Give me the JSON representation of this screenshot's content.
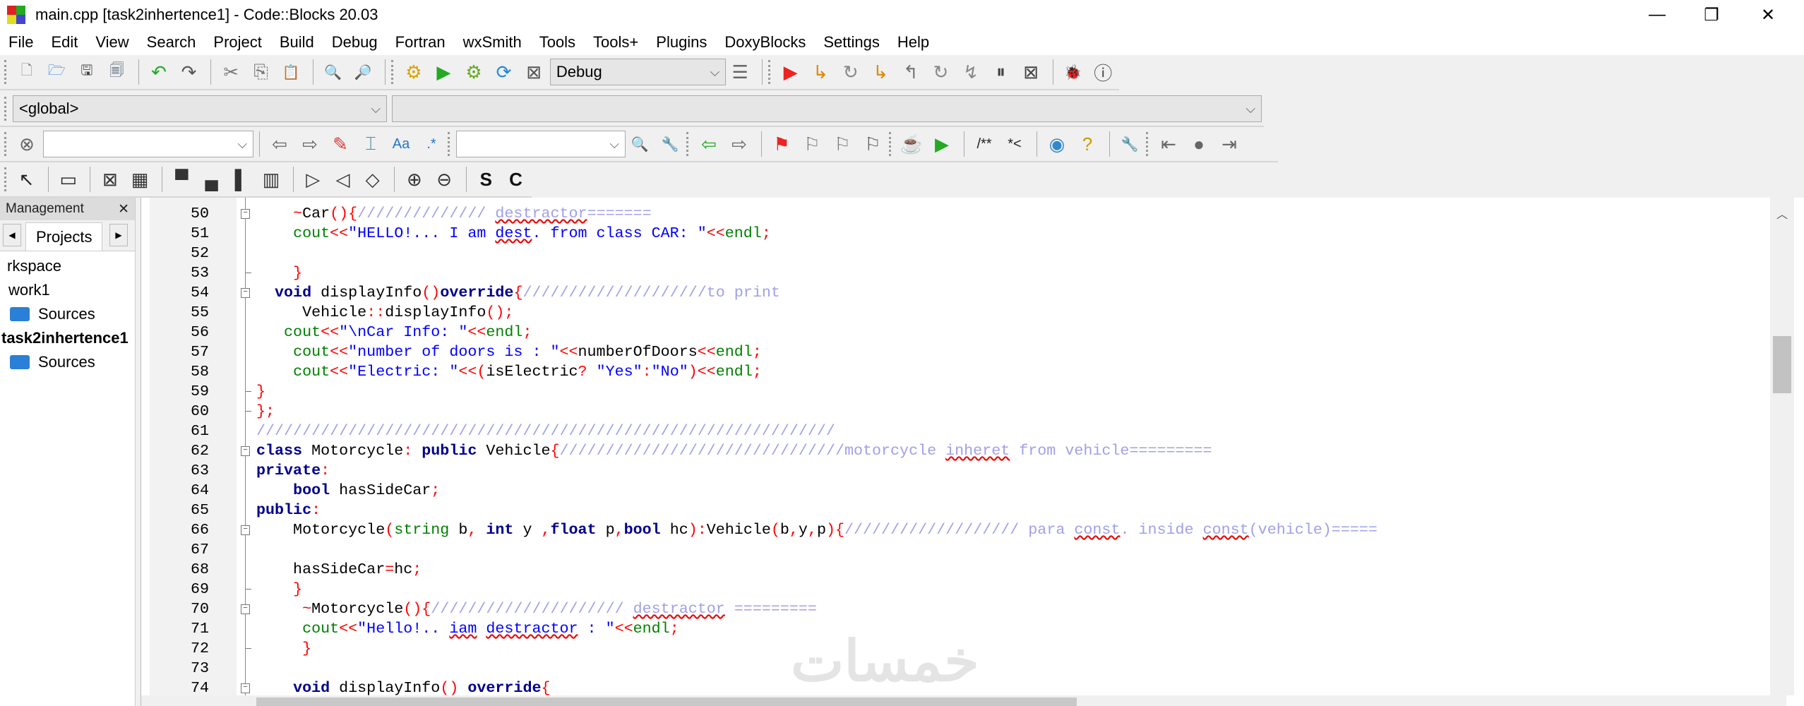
{
  "window": {
    "title": "main.cpp [task2inhertence1] - Code::Blocks 20.03",
    "minimize": "—",
    "maximize": "❐",
    "close": "✕"
  },
  "menu": [
    "File",
    "Edit",
    "View",
    "Search",
    "Project",
    "Build",
    "Debug",
    "Fortran",
    "wxSmith",
    "Tools",
    "Tools+",
    "Plugins",
    "DoxyBlocks",
    "Settings",
    "Help"
  ],
  "toolbar1": {
    "file_icons": [
      "new-file",
      "open",
      "save",
      "save-all",
      "|",
      "undo",
      "redo",
      "|",
      "cut",
      "copy",
      "paste",
      "|",
      "find",
      "replace"
    ],
    "build_icons": [
      "build",
      "run",
      "build-and-run",
      "rebuild",
      "abort"
    ],
    "build_target": "Debug",
    "after_target": [
      "build-options"
    ],
    "debug_icons": [
      "debug-continue",
      "run-to-cursor",
      "next-line",
      "step-into",
      "step-out",
      "next-instruction",
      "step-into-instruction",
      "break-debugger",
      "stop-debugger",
      "|",
      "debugging-windows",
      "various-info"
    ]
  },
  "toolbar2": {
    "scope": "<global>",
    "symbol": ""
  },
  "toolbar3": {
    "search_value": "",
    "icons_a": [
      "prev",
      "next",
      "highlight",
      "selected-occurrence",
      "match-case",
      "regex"
    ],
    "search2_value": "",
    "icons_b": [
      "zoom-search",
      "options"
    ],
    "icons_c": [
      "jump-back",
      "jump-forward",
      "|",
      "toggle-bookmark",
      "prev-bookmark",
      "next-bookmark",
      "clear-bookmarks"
    ],
    "icons_d": [
      "code-completion",
      "run-codecompletion",
      "|",
      "doxy-block",
      "doxy-line",
      "|",
      "html-help",
      "chm-help",
      "|",
      "wrench"
    ],
    "icons_e": [
      "goto-start",
      "center",
      "goto-end"
    ]
  },
  "toolbar4": {
    "icons": [
      "pointer",
      "|",
      "box",
      "|",
      "sizer-grid",
      "sizer-flex",
      "|",
      "align-top",
      "align-bottom",
      "align-left",
      "align-center",
      "|",
      "border-right",
      "border-left",
      "border-both",
      "|",
      "zoom-in",
      "zoom-out",
      "|",
      "symbol-s",
      "symbol-c"
    ]
  },
  "management": {
    "title": "Management",
    "close": "✕",
    "tab": "Projects",
    "tree": [
      {
        "label": "rkspace",
        "bold": false,
        "folder": false
      },
      {
        "label": "work1",
        "bold": false,
        "folder": false
      },
      {
        "label": "Sources",
        "bold": false,
        "folder": true
      },
      {
        "label": "task2inhertence1",
        "bold": true,
        "folder": false
      },
      {
        "label": "Sources",
        "bold": false,
        "folder": true
      }
    ]
  },
  "syntax_colors": {
    "keyword": "#00008b",
    "string": "#0000ff",
    "operator": "#ff0000",
    "comment": "#a0a0e8",
    "builtin": "#008000"
  },
  "editor": {
    "lines": [
      {
        "n": 50,
        "fold": "open",
        "tokens": [
          [
            "t",
            "    "
          ],
          [
            "o",
            "~"
          ],
          [
            "t",
            "Car"
          ],
          [
            "o",
            "(){"
          ],
          [
            "c",
            "////////////// "
          ],
          [
            "cs",
            "destractor"
          ],
          [
            "c",
            "======="
          ]
        ]
      },
      {
        "n": 51,
        "tokens": [
          [
            "t",
            "    "
          ],
          [
            "f",
            "cout"
          ],
          [
            "o",
            "<<"
          ],
          [
            "s",
            "\"HELLO!... I am "
          ],
          [
            "ss",
            "dest"
          ],
          [
            "s",
            ". from class CAR: \""
          ],
          [
            "o",
            "<<"
          ],
          [
            "f",
            "endl"
          ],
          [
            "o",
            ";"
          ]
        ]
      },
      {
        "n": 52,
        "tokens": []
      },
      {
        "n": 53,
        "fold": "end",
        "tokens": [
          [
            "t",
            "    "
          ],
          [
            "o",
            "}"
          ]
        ]
      },
      {
        "n": 54,
        "fold": "open",
        "tokens": [
          [
            "t",
            "  "
          ],
          [
            "k",
            "void"
          ],
          [
            "t",
            " displayInfo"
          ],
          [
            "o",
            "()"
          ],
          [
            "k",
            "override"
          ],
          [
            "o",
            "{"
          ],
          [
            "c",
            "////////////////////to print"
          ]
        ]
      },
      {
        "n": 55,
        "tokens": [
          [
            "t",
            "     Vehicle"
          ],
          [
            "o",
            "::"
          ],
          [
            "t",
            "displayInfo"
          ],
          [
            "o",
            "();"
          ]
        ]
      },
      {
        "n": 56,
        "tokens": [
          [
            "t",
            "   "
          ],
          [
            "f",
            "cout"
          ],
          [
            "o",
            "<<"
          ],
          [
            "s",
            "\"\\nCar Info: \""
          ],
          [
            "o",
            "<<"
          ],
          [
            "f",
            "endl"
          ],
          [
            "o",
            ";"
          ]
        ]
      },
      {
        "n": 57,
        "tokens": [
          [
            "t",
            "    "
          ],
          [
            "f",
            "cout"
          ],
          [
            "o",
            "<<"
          ],
          [
            "s",
            "\"number of doors is : \""
          ],
          [
            "o",
            "<<"
          ],
          [
            "t",
            "numberOfDoors"
          ],
          [
            "o",
            "<<"
          ],
          [
            "f",
            "endl"
          ],
          [
            "o",
            ";"
          ]
        ]
      },
      {
        "n": 58,
        "tokens": [
          [
            "t",
            "    "
          ],
          [
            "f",
            "cout"
          ],
          [
            "o",
            "<<"
          ],
          [
            "s",
            "\"Electric: \""
          ],
          [
            "o",
            "<<("
          ],
          [
            "t",
            "isElectric"
          ],
          [
            "o",
            "?"
          ],
          [
            "t",
            " "
          ],
          [
            "s",
            "\"Yes\""
          ],
          [
            "o",
            ":"
          ],
          [
            "s",
            "\"No\""
          ],
          [
            "o",
            ")<<"
          ],
          [
            "f",
            "endl"
          ],
          [
            "o",
            ";"
          ]
        ]
      },
      {
        "n": 59,
        "fold": "end",
        "tokens": [
          [
            "o",
            "}"
          ]
        ]
      },
      {
        "n": 60,
        "fold": "end",
        "tokens": [
          [
            "o",
            "};"
          ]
        ]
      },
      {
        "n": 61,
        "tokens": [
          [
            "c",
            "///////////////////////////////////////////////////////////////"
          ]
        ]
      },
      {
        "n": 62,
        "fold": "open",
        "tokens": [
          [
            "k",
            "class"
          ],
          [
            "t",
            " Motorcycle"
          ],
          [
            "o",
            ":"
          ],
          [
            "t",
            " "
          ],
          [
            "k",
            "public"
          ],
          [
            "t",
            " Vehicle"
          ],
          [
            "o",
            "{"
          ],
          [
            "c",
            "///////////////////////////////motorcycle "
          ],
          [
            "cs",
            "inheret"
          ],
          [
            "c",
            " from vehicle========="
          ]
        ]
      },
      {
        "n": 63,
        "tokens": [
          [
            "k",
            "private"
          ],
          [
            "o",
            ":"
          ]
        ]
      },
      {
        "n": 64,
        "tokens": [
          [
            "t",
            "    "
          ],
          [
            "k",
            "bool"
          ],
          [
            "t",
            " hasSideCar"
          ],
          [
            "o",
            ";"
          ]
        ]
      },
      {
        "n": 65,
        "tokens": [
          [
            "k",
            "public"
          ],
          [
            "o",
            ":"
          ]
        ]
      },
      {
        "n": 66,
        "fold": "open",
        "tokens": [
          [
            "t",
            "    Motorcycle"
          ],
          [
            "o",
            "("
          ],
          [
            "f",
            "string"
          ],
          [
            "t",
            " b"
          ],
          [
            "o",
            ","
          ],
          [
            "t",
            " "
          ],
          [
            "k",
            "int"
          ],
          [
            "t",
            " y "
          ],
          [
            "o",
            ","
          ],
          [
            "k",
            "float"
          ],
          [
            "t",
            " p"
          ],
          [
            "o",
            ","
          ],
          [
            "k",
            "bool"
          ],
          [
            "t",
            " hc"
          ],
          [
            "o",
            "):"
          ],
          [
            "t",
            "Vehicle"
          ],
          [
            "o",
            "("
          ],
          [
            "t",
            "b"
          ],
          [
            "o",
            ","
          ],
          [
            "t",
            "y"
          ],
          [
            "o",
            ","
          ],
          [
            "t",
            "p"
          ],
          [
            "o",
            "){"
          ],
          [
            "c",
            "/////////////////// para "
          ],
          [
            "cs",
            "const"
          ],
          [
            "c",
            ". inside "
          ],
          [
            "cs",
            "const"
          ],
          [
            "c",
            "(vehicle)====="
          ]
        ]
      },
      {
        "n": 67,
        "tokens": []
      },
      {
        "n": 68,
        "tokens": [
          [
            "t",
            "    hasSideCar"
          ],
          [
            "o",
            "="
          ],
          [
            "t",
            "hc"
          ],
          [
            "o",
            ";"
          ]
        ]
      },
      {
        "n": 69,
        "fold": "end",
        "tokens": [
          [
            "t",
            "    "
          ],
          [
            "o",
            "}"
          ]
        ]
      },
      {
        "n": 70,
        "fold": "open",
        "tokens": [
          [
            "t",
            "     "
          ],
          [
            "o",
            "~"
          ],
          [
            "t",
            "Motorcycle"
          ],
          [
            "o",
            "(){"
          ],
          [
            "c",
            "///////////////////// "
          ],
          [
            "cs",
            "destractor"
          ],
          [
            "c",
            " ========="
          ]
        ]
      },
      {
        "n": 71,
        "tokens": [
          [
            "t",
            "     "
          ],
          [
            "f",
            "cout"
          ],
          [
            "o",
            "<<"
          ],
          [
            "s",
            "\"Hello!.. "
          ],
          [
            "ss",
            "iam"
          ],
          [
            "s",
            " "
          ],
          [
            "ss",
            "destractor"
          ],
          [
            "s",
            " : \""
          ],
          [
            "o",
            "<<"
          ],
          [
            "f",
            "endl"
          ],
          [
            "o",
            ";"
          ]
        ]
      },
      {
        "n": 72,
        "fold": "end",
        "tokens": [
          [
            "t",
            "     "
          ],
          [
            "o",
            "}"
          ]
        ]
      },
      {
        "n": 73,
        "tokens": []
      },
      {
        "n": 74,
        "fold": "open",
        "tokens": [
          [
            "t",
            "    "
          ],
          [
            "k",
            "void"
          ],
          [
            "t",
            " displayInfo"
          ],
          [
            "o",
            "()"
          ],
          [
            "t",
            " "
          ],
          [
            "k",
            "override"
          ],
          [
            "o",
            "{"
          ]
        ]
      }
    ]
  },
  "watermark": "خمسات"
}
